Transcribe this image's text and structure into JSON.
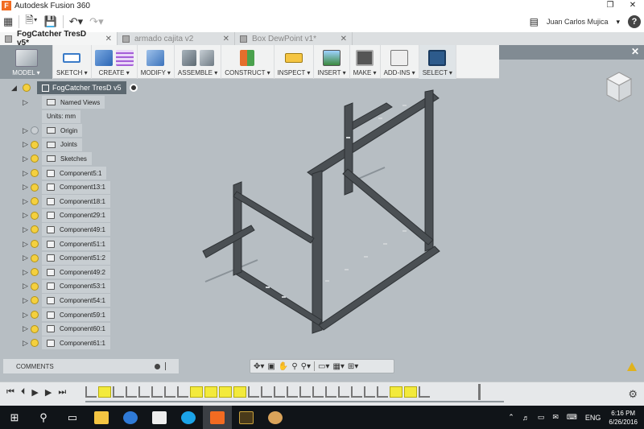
{
  "window": {
    "title": "Autodesk Fusion 360",
    "restore_icon": "restore-icon",
    "close_icon": "close-icon"
  },
  "quick_access": {
    "grid_icon": "apps-grid-icon",
    "file_icon": "file-icon",
    "save_icon": "save-icon",
    "undo_icon": "undo-icon",
    "redo_icon": "redo-icon",
    "user_name": "Juan Carlos Mujica",
    "help_label": "?"
  },
  "tabs": [
    {
      "label": "FogCatcher TresD v5*",
      "active": true
    },
    {
      "label": "armado cajita v2",
      "active": false
    },
    {
      "label": "Box DewPoint v1*",
      "active": false
    }
  ],
  "toolbar": {
    "groups": [
      {
        "label": "MODEL ▾"
      },
      {
        "label": "SKETCH ▾"
      },
      {
        "label": "CREATE ▾"
      },
      {
        "label": "MODIFY ▾"
      },
      {
        "label": "ASSEMBLE ▾"
      },
      {
        "label": "CONSTRUCT ▾"
      },
      {
        "label": "INSPECT ▾"
      },
      {
        "label": "INSERT ▾"
      },
      {
        "label": "MAKE ▾"
      },
      {
        "label": "ADD-INS ▾"
      },
      {
        "label": "SELECT ▾"
      }
    ]
  },
  "browser": {
    "root": "FogCatcher TresD v5",
    "items": [
      {
        "label": "Named Views",
        "type": "folder",
        "bulb": false,
        "arrow": true
      },
      {
        "label": "Units: mm",
        "type": "units",
        "bulb": false,
        "arrow": false
      },
      {
        "label": "Origin",
        "type": "folder",
        "bulb": "off",
        "arrow": true
      },
      {
        "label": "Joints",
        "type": "folder",
        "bulb": "on",
        "arrow": true
      },
      {
        "label": "Sketches",
        "type": "folder",
        "bulb": "on",
        "arrow": true
      },
      {
        "label": "Component5:1",
        "type": "comp",
        "bulb": "on",
        "arrow": true
      },
      {
        "label": "Component13:1",
        "type": "comp",
        "bulb": "on",
        "arrow": true
      },
      {
        "label": "Component18:1",
        "type": "comp",
        "bulb": "on",
        "arrow": true
      },
      {
        "label": "Component29:1",
        "type": "comp",
        "bulb": "on",
        "arrow": true
      },
      {
        "label": "Component49:1",
        "type": "comp",
        "bulb": "on",
        "arrow": true
      },
      {
        "label": "Component51:1",
        "type": "comp",
        "bulb": "on",
        "arrow": true
      },
      {
        "label": "Component51:2",
        "type": "comp",
        "bulb": "on",
        "arrow": true
      },
      {
        "label": "Component49:2",
        "type": "comp",
        "bulb": "on",
        "arrow": true
      },
      {
        "label": "Component53:1",
        "type": "comp",
        "bulb": "on",
        "arrow": true
      },
      {
        "label": "Component54:1",
        "type": "comp",
        "bulb": "on",
        "arrow": true
      },
      {
        "label": "Component59:1",
        "type": "comp",
        "bulb": "on",
        "arrow": true
      },
      {
        "label": "Component60:1",
        "type": "comp",
        "bulb": "on",
        "arrow": true
      },
      {
        "label": "Component61:1",
        "type": "comp",
        "bulb": "on",
        "arrow": true
      }
    ]
  },
  "comments": {
    "label": "COMMENTS"
  },
  "navbar": {
    "icons": [
      "orbit-icon",
      "look-at-icon",
      "pan-icon",
      "zoom-fit-icon",
      "zoom-icon",
      "display-settings-icon",
      "grid-icon",
      "viewports-icon"
    ]
  },
  "timeline": {
    "controls": [
      "⏮",
      "⏴",
      "▶",
      "▶",
      "⏭"
    ],
    "items": [
      "feat",
      "hl",
      "feat",
      "feat",
      "feat",
      "feat",
      "feat",
      "feat",
      "hl",
      "hl",
      "hl",
      "hl",
      "feat",
      "feat",
      "feat",
      "feat",
      "feat",
      "feat",
      "feat",
      "feat",
      "feat",
      "feat",
      "feat",
      "hl",
      "hl",
      "feat",
      "feat",
      "feat",
      "feat",
      "hl",
      "hl",
      "hl",
      "hl",
      "feat",
      "feat",
      "feat",
      "feat"
    ]
  },
  "taskbar": {
    "apps": [
      "windows-start-icon",
      "search-icon",
      "task-view-icon",
      "file-explorer-icon",
      "edge-icon",
      "store-icon",
      "skype-icon",
      "fusion360-icon",
      "muse-icon",
      "paint-icon"
    ],
    "tray_lang": "ENG",
    "time": "6:16 PM",
    "date": "6/26/2016"
  },
  "colors": {
    "accent": "#f26b21",
    "viewport_bg": "#b7bec3",
    "highlight": "#f3ea3b"
  }
}
